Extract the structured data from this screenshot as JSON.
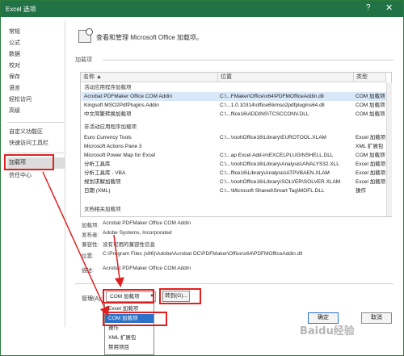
{
  "window": {
    "title": "Excel 选项",
    "help": "?",
    "close": "✕"
  },
  "sidebar": {
    "items": [
      {
        "label": "常规"
      },
      {
        "label": "公式"
      },
      {
        "label": "数据"
      },
      {
        "label": "校对"
      },
      {
        "label": "保存"
      },
      {
        "label": "语言"
      },
      {
        "label": "轻松访问"
      },
      {
        "label": "高级"
      },
      {
        "label": "自定义功能区"
      },
      {
        "label": "快速访问工具栏"
      },
      {
        "label": "加载项"
      },
      {
        "label": "信任中心"
      }
    ]
  },
  "header": {
    "text": "查看和管理 Microsoft Office 加载项。"
  },
  "addins": {
    "section_title": "加载项",
    "columns": [
      "名称 ▲",
      "位置",
      "类型"
    ],
    "active_group": "活动应用程序加载项",
    "active_rows": [
      [
        "Acrobat PDFMaker Office COM Addin",
        "C:\\...FMaker\\Office\\x64\\PDFMOfficeAddin.dll",
        "COM 加载项"
      ],
      [
        "Kingsoft MSO2PdfPlugins Addin",
        "C:\\...1.0.10314\\office6\\kmso2pdfplugins64.dll",
        "COM 加载项"
      ],
      [
        "中文简繁转换加载项",
        "C:\\...ffice16\\ADDINS\\TCSCCONV.DLL",
        "COM 加载项"
      ]
    ],
    "inactive_group": "非活动应用程序加载项",
    "inactive_rows": [
      [
        "Euro Currency Tools",
        "C:\\...\\root\\Office16\\Library\\EUROTOOL.XLAM",
        "Excel 加载项"
      ],
      [
        "Microsoft Actions Pane 3",
        "",
        "XML 扩展包"
      ],
      [
        "Microsoft Power Map for Excel",
        "C:\\...ap Excel Add-in\\EXCELPLUGINSHELL.DLL",
        "COM 加载项"
      ],
      [
        "分析工具库",
        "C:\\...\\root\\Office16\\Library\\Analysis\\ANALYS32.XLL",
        "Excel 加载项"
      ],
      [
        "分析工具库 - VBA",
        "C:\\...ffice16\\Library\\Analysis\\ATPVBAEN.XLAM",
        "Excel 加载项"
      ],
      [
        "规划求解加载项",
        "C:\\...\\root\\Office16\\Library\\SOLVER\\SOLVER.XLAM",
        "Excel 加载项"
      ],
      [
        "日期 (XML)",
        "C:\\...\\Microsoft Shared\\Smart Tag\\MOFL.DLL",
        "操作"
      ]
    ],
    "doc_group": "文档相关加载项"
  },
  "details": {
    "addin_label": "加载项:",
    "addin_value": "Acrobat PDFMaker Office COM Addin",
    "publisher_label": "发布者:",
    "publisher_value": "Adobe Systems, Incorporated",
    "compat_label": "兼容性:",
    "compat_value": "没有可用的兼容性信息",
    "location_label": "位置:",
    "location_value": "C:\\Program Files (x86)\\Adobe\\Acrobat DC\\PDFMaker\\Office\\x64\\PDFMOfficeAddin.dll",
    "desc_label": "描述:",
    "desc_value": "Acrobat PDFMaker Office COM Addin"
  },
  "manage": {
    "label": "管理(A):",
    "selected": "COM 加载项",
    "goto": "转到(G)...",
    "options": [
      "Excel 加载项",
      "COM 加载项",
      "操作",
      "XML 扩展包",
      "禁用项目"
    ]
  },
  "footer": {
    "ok": "确定",
    "cancel": "取消"
  },
  "watermark": "Baidu经验",
  "colors": {
    "title_bar": "#217346",
    "highlight": "#e02020",
    "selection": "#2b72c8"
  }
}
